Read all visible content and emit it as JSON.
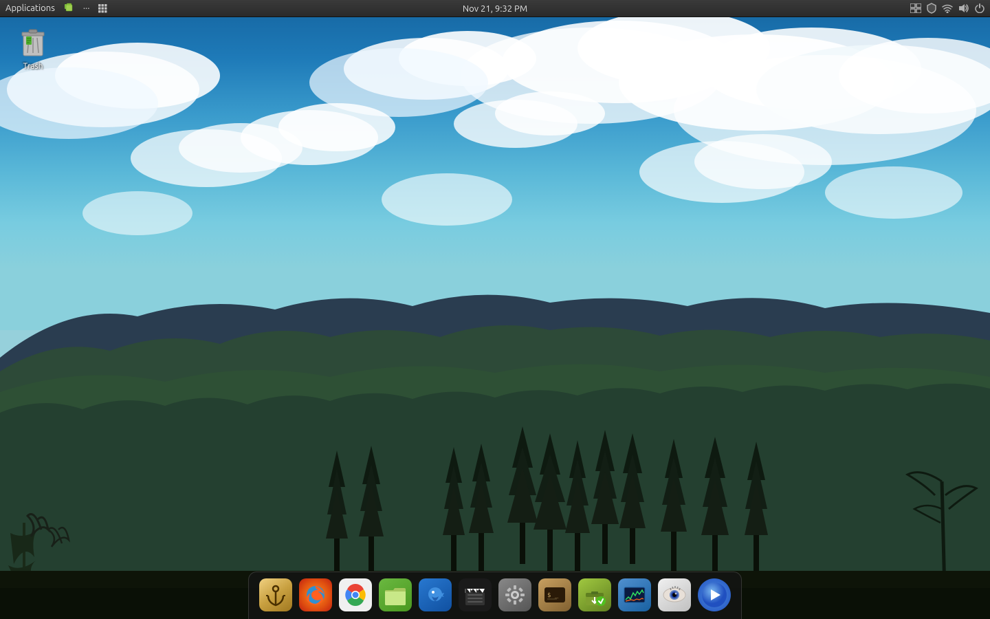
{
  "topPanel": {
    "applications_label": "Applications",
    "datetime": "Nov 21,  9:32 PM",
    "icons": {
      "files_icon": "📁",
      "dots_icon": "···",
      "grid_icon": "⣿"
    },
    "tray": {
      "windows_icon": "⊞",
      "shield_icon": "🛡",
      "wifi_icon": "📶",
      "volume_icon": "🔊",
      "power_icon": "⏻"
    }
  },
  "desktop": {
    "trash": {
      "label": "Trash"
    }
  },
  "dock": {
    "items": [
      {
        "name": "anchor",
        "label": "Anchor",
        "class": "icon-anchor"
      },
      {
        "name": "firefox",
        "label": "Firefox",
        "class": "icon-firefox"
      },
      {
        "name": "chromium",
        "label": "Chromium",
        "class": "icon-chromium"
      },
      {
        "name": "files",
        "label": "Files",
        "class": "icon-files"
      },
      {
        "name": "beak",
        "label": "Beak",
        "class": "icon-beak"
      },
      {
        "name": "clapper",
        "label": "Clapper",
        "class": "icon-clap"
      },
      {
        "name": "settings",
        "label": "Settings",
        "class": "icon-settings"
      },
      {
        "name": "terminal",
        "label": "Terminal",
        "class": "icon-terminal"
      },
      {
        "name": "installer",
        "label": "Installer",
        "class": "icon-installer"
      },
      {
        "name": "system-monitor",
        "label": "System Monitor",
        "class": "icon-monitor"
      },
      {
        "name": "eye",
        "label": "Eye",
        "class": "icon-eye"
      },
      {
        "name": "media-player",
        "label": "Media Player",
        "class": "icon-play"
      }
    ]
  }
}
